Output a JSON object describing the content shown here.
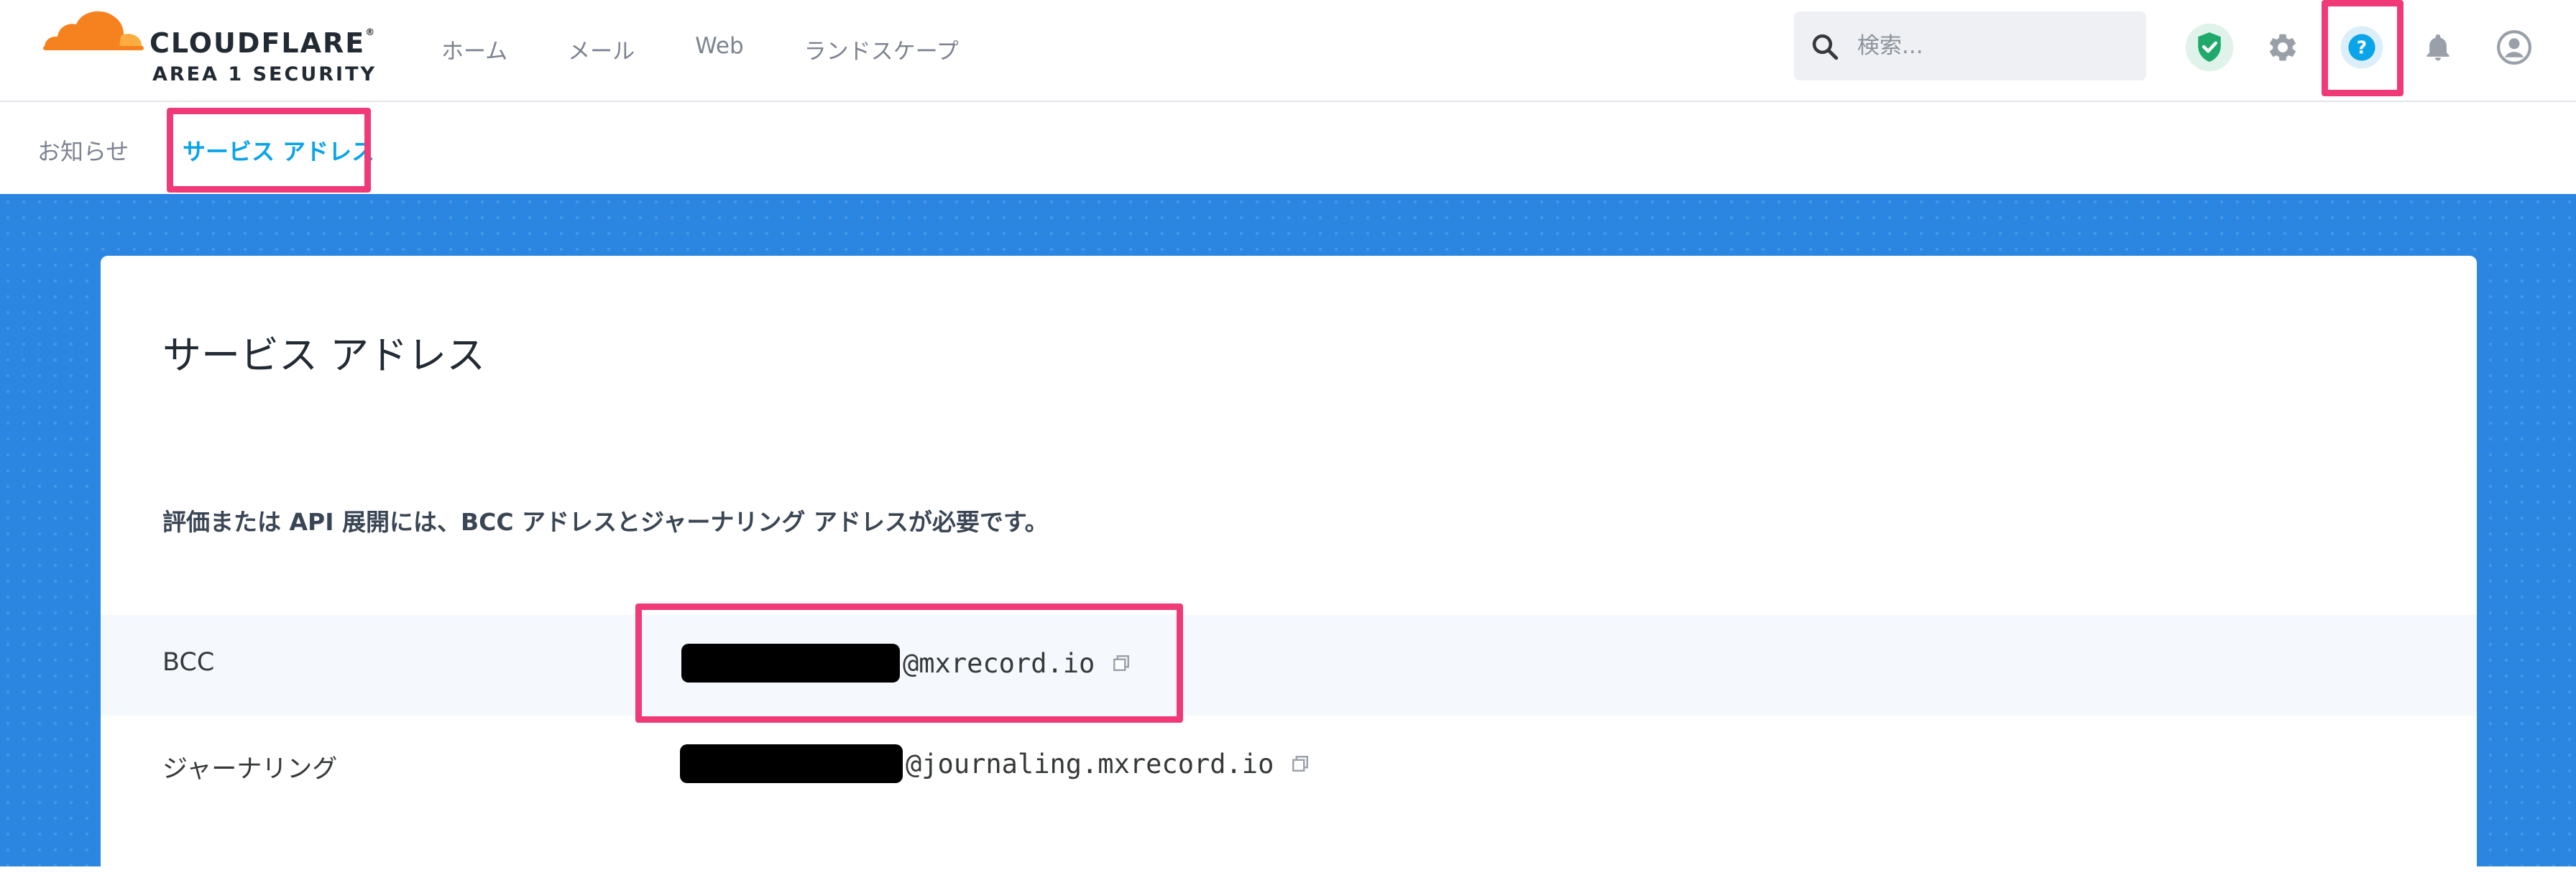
{
  "brand": {
    "name": "CLOUDFLARE",
    "registered_mark": "®",
    "product": "AREA 1 SECURITY",
    "orange": "#f6821f",
    "light_orange": "#fbad41"
  },
  "header": {
    "nav": [
      {
        "label": "ホーム"
      },
      {
        "label": "メール"
      },
      {
        "label": "Web"
      },
      {
        "label": "ランドスケープ"
      }
    ],
    "search": {
      "placeholder": "検索...",
      "value": "",
      "icon": "search-icon"
    },
    "icons": [
      "shield-check-icon",
      "gear-icon",
      "help-icon",
      "bell-icon",
      "user-account-icon"
    ]
  },
  "subnav": {
    "items": [
      {
        "label": "お知らせ",
        "active": false
      },
      {
        "label": "サービス アドレス",
        "active": true
      }
    ]
  },
  "main": {
    "title": "サービス アドレス",
    "description": "評価または API 展開には、BCC アドレスとジャーナリング アドレスが必要です。",
    "rows": [
      {
        "label": "BCC",
        "value_redacted": true,
        "domain": "@mxrecord.io",
        "action_icon": "copy-icon"
      },
      {
        "label": "ジャーナリング",
        "value_redacted": true,
        "domain": "@journaling.mxrecord.io",
        "action_icon": "copy-icon"
      }
    ]
  },
  "colors": {
    "accent": "#0aa4e8",
    "highlight": "#f03a78",
    "background_blue": "#2b86e1",
    "shield_green": "#1faa6b"
  }
}
